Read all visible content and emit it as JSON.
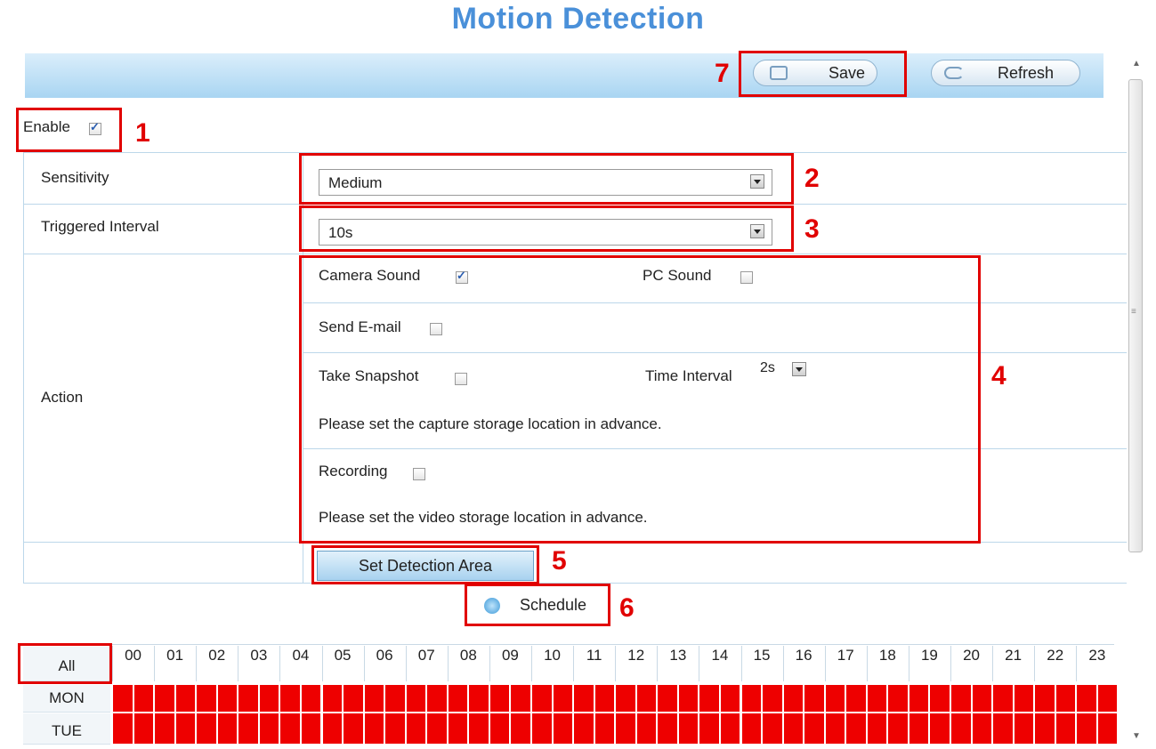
{
  "title": "Motion Detection",
  "toolbar": {
    "save_label": "Save",
    "refresh_label": "Refresh",
    "save_marker": "7"
  },
  "enable": {
    "label": "Enable",
    "checked": true,
    "marker": "1"
  },
  "sensitivity": {
    "label": "Sensitivity",
    "value": "Medium",
    "marker": "2"
  },
  "triggered_interval": {
    "label": "Triggered Interval",
    "value": "10s",
    "marker": "3"
  },
  "action": {
    "label": "Action",
    "marker": "4",
    "camera_sound": {
      "label": "Camera Sound",
      "checked": true
    },
    "pc_sound": {
      "label": "PC Sound",
      "checked": false
    },
    "send_email": {
      "label": "Send E-mail",
      "checked": false
    },
    "take_snapshot": {
      "label": "Take Snapshot",
      "checked": false
    },
    "time_interval": {
      "label": "Time Interval",
      "value": "2s"
    },
    "snapshot_note": "Please set the capture storage location in advance.",
    "recording": {
      "label": "Recording",
      "checked": false
    },
    "recording_note": "Please set the video storage location in advance."
  },
  "set_area": {
    "label": "Set Detection Area",
    "marker": "5"
  },
  "schedule": {
    "label": "Schedule",
    "marker": "6"
  },
  "grid": {
    "all_label": "All",
    "hours": [
      "00",
      "01",
      "02",
      "03",
      "04",
      "05",
      "06",
      "07",
      "08",
      "09",
      "10",
      "11",
      "12",
      "13",
      "14",
      "15",
      "16",
      "17",
      "18",
      "19",
      "20",
      "21",
      "22",
      "23"
    ],
    "days": [
      "MON",
      "TUE"
    ],
    "active_color": "#ee0000"
  },
  "colors": {
    "title": "#4a90d9",
    "marker": "#e10000",
    "toolbar": "#a9d5f2"
  }
}
